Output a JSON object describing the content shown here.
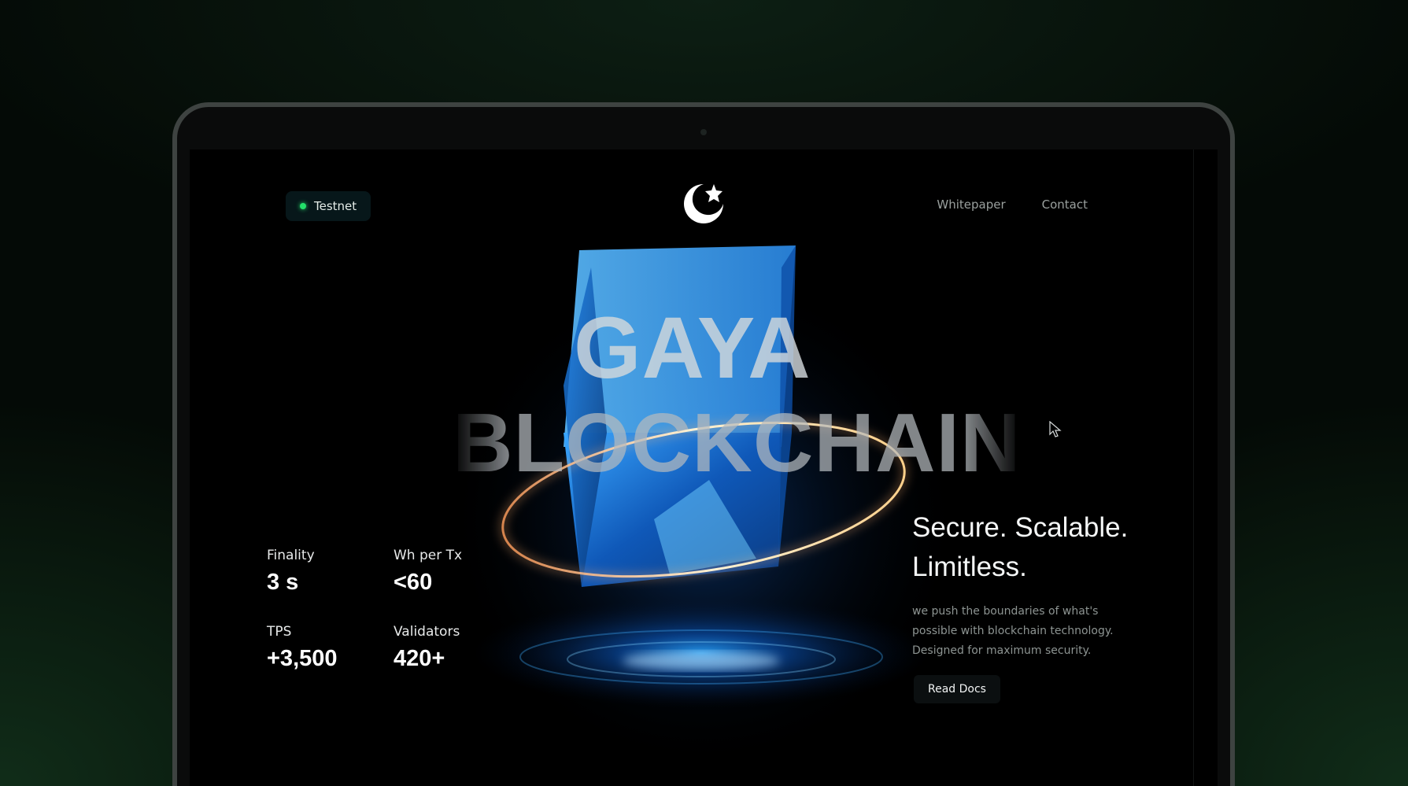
{
  "header": {
    "status_label": "Testnet",
    "status_color": "#23e06a",
    "logo": "crescent-star-logo-icon",
    "nav": [
      {
        "label": "Whitepaper"
      },
      {
        "label": "Contact"
      }
    ]
  },
  "hero": {
    "title_line1": "GAYA",
    "title_line2": "BLOCKCHAIN"
  },
  "stats": [
    {
      "label": "Finality",
      "value": "3 s"
    },
    {
      "label": "Wh per Tx",
      "value": "<60"
    },
    {
      "label": "TPS",
      "value": "+3,500"
    },
    {
      "label": "Validators",
      "value": "420+"
    }
  ],
  "panel": {
    "tagline": "Secure. Scalable. Limitless.",
    "description": "we push the boundaries of what's possible with blockchain technology. Designed for maximum security.",
    "cta_label": "Read Docs"
  },
  "colors": {
    "accent_blue": "#1a8cff",
    "ring_gold": "#f3c98a"
  }
}
